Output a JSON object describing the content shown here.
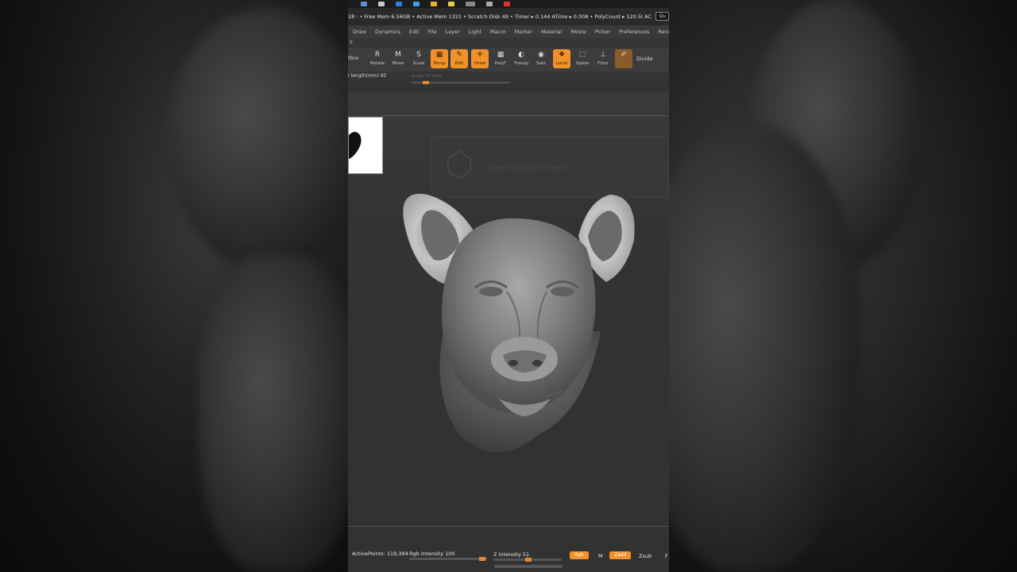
{
  "statusbar": {
    "text": "28  : • Free Mem 6.56GB • Active Mem 1321 • Scratch Disk 49 • Timer ▸ 0.144 ATime ▸ 0.008 • PolyCount ▸ 120.5I  AC",
    "quick_save": "Qu"
  },
  "menu": [
    "Draw",
    "Dynamics",
    "Edit",
    "File",
    "Layer",
    "Light",
    "Macro",
    "Marker",
    "Material",
    "Movie",
    "Picker",
    "Preferences",
    "Rend"
  ],
  "subbar_label": "9",
  "toolbar": {
    "left_label": "tBox",
    "tools": [
      {
        "label": "Rotate",
        "glyph": "R",
        "active": false
      },
      {
        "label": "Move",
        "glyph": "M",
        "active": false
      },
      {
        "label": "Scale",
        "glyph": "S",
        "active": false
      },
      {
        "label": "Persp",
        "glyph": "▦",
        "active": true
      },
      {
        "label": "Edit",
        "glyph": "✎",
        "active": true
      },
      {
        "label": "Draw",
        "glyph": "✛",
        "active": true
      },
      {
        "label": "PolyF",
        "glyph": "▦",
        "active": false
      },
      {
        "label": "Transp",
        "glyph": "◐",
        "active": false
      },
      {
        "label": "Solo",
        "glyph": "◉",
        "active": false
      },
      {
        "label": "Local",
        "glyph": "❖",
        "active": true
      },
      {
        "label": "Xpose",
        "glyph": "⬚",
        "active": false
      },
      {
        "label": "Floor",
        "glyph": "⊥",
        "active": false
      },
      {
        "label": "",
        "glyph": "✐",
        "active": "dim"
      }
    ],
    "divide_label": "Divide"
  },
  "focal": {
    "label": "l length(mm) 85",
    "angle_label": "Angle Of View"
  },
  "ghost_panel_text": "LightBox ▸ ZBrush 2023 Content",
  "bottom": {
    "active_points": "ActivePoints: 119,394",
    "rgb_intensity": "Rgb Intensity 100",
    "z_intensity": "Z Intensity 51",
    "rgb": "Rgb",
    "m": "M",
    "zadd": "Zadd",
    "zsub": "Zsub",
    "f": "F"
  },
  "colors": {
    "accent": "#f0912a",
    "panel": "#3c3c3c",
    "canvas": "#333333"
  }
}
